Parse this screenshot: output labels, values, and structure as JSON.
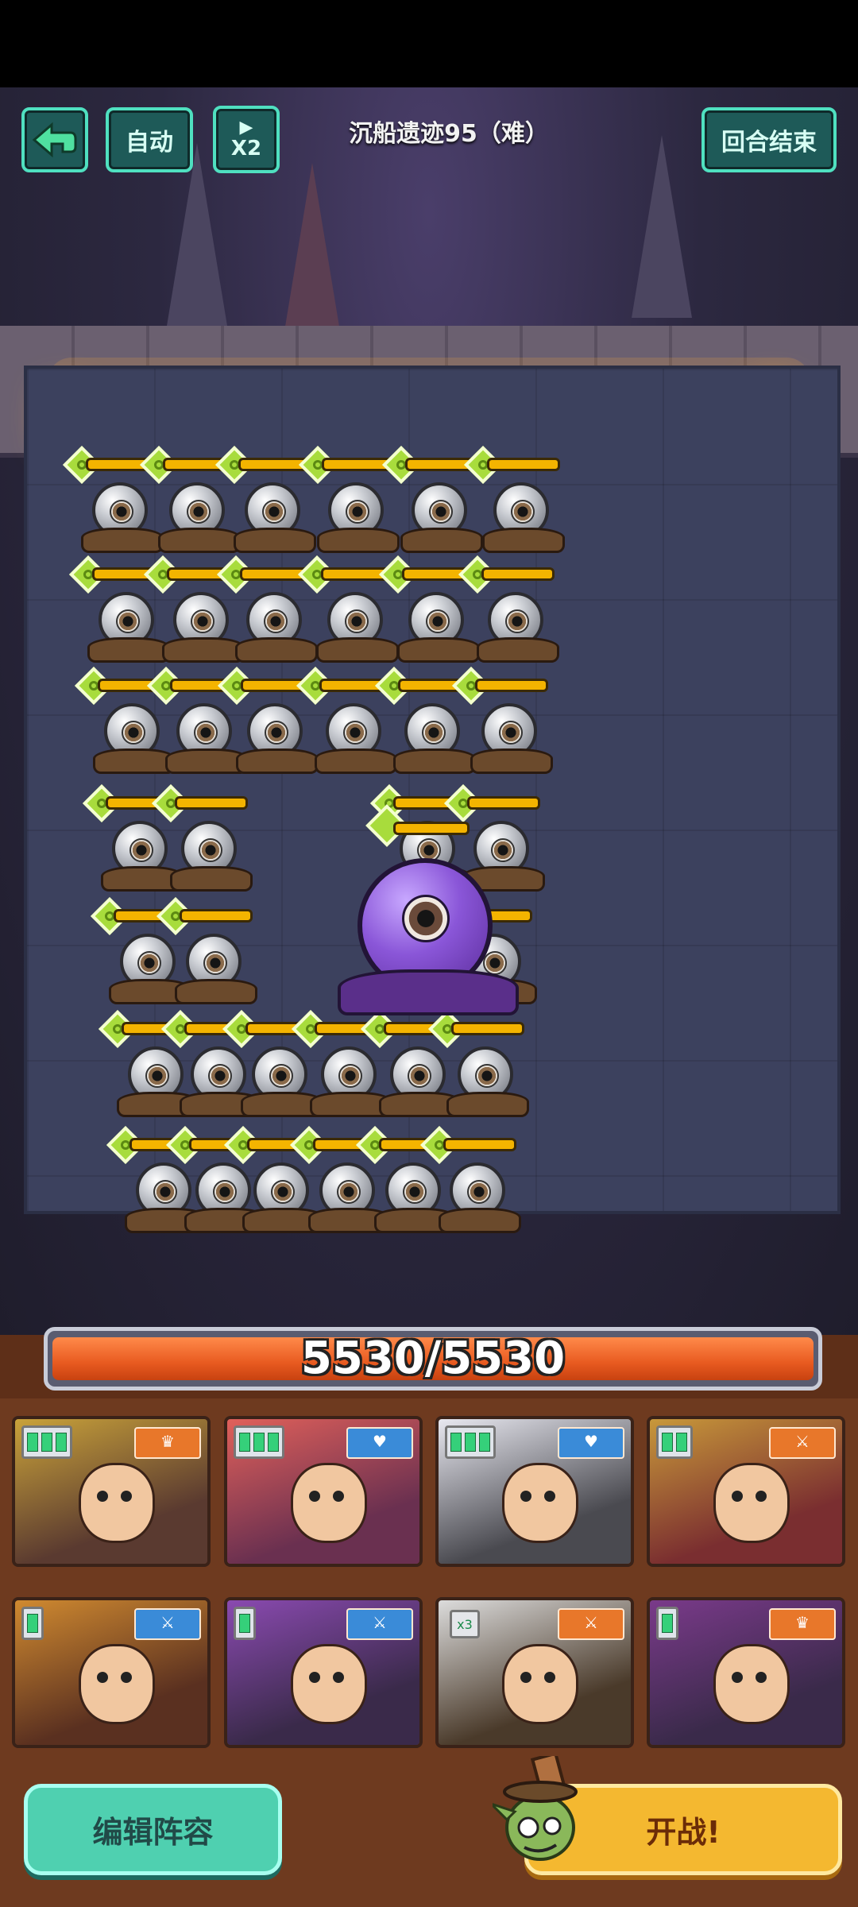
{
  "header": {
    "back_icon": "back-arrow-icon",
    "auto_label": "自动",
    "speed_label": "X2",
    "stage_title": "沉船遗迹95（难）",
    "end_turn_label": "回合结束"
  },
  "board": {
    "enemy_name": "eyeball-orb-enemy",
    "boss_name": "purple-eyeball-boss",
    "rows": 7,
    "cols": 6
  },
  "boss_hp": {
    "current": 5530,
    "max": 5530,
    "text": "5530/5530",
    "fraction": 1.0
  },
  "team": {
    "cards": [
      {
        "slots": 3,
        "badge": "orange",
        "badge_icon": "crown-icon"
      },
      {
        "slots": 3,
        "badge": "blue",
        "badge_icon": "heart-icon"
      },
      {
        "slots": 3,
        "badge": "blue",
        "badge_icon": "heart-icon"
      },
      {
        "slots": 2,
        "badge": "orange",
        "badge_icon": "sword-icon"
      },
      {
        "slots": 1,
        "badge": "blue",
        "badge_icon": "sword-icon"
      },
      {
        "slots": 1,
        "badge": "blue",
        "badge_icon": "sword-icon"
      },
      {
        "mult": "x3",
        "badge": "orange",
        "badge_icon": "sword-icon"
      },
      {
        "slots": 1,
        "badge": "orange",
        "badge_icon": "crown-icon"
      }
    ]
  },
  "footer": {
    "edit_label": "编辑阵容",
    "fight_label": "开战!"
  },
  "colors": {
    "accent_teal": "#4fe0c0",
    "hp_orange": "#e85a20",
    "unit_hp_yellow": "#f4b400",
    "fight_yellow": "#f4b830"
  }
}
